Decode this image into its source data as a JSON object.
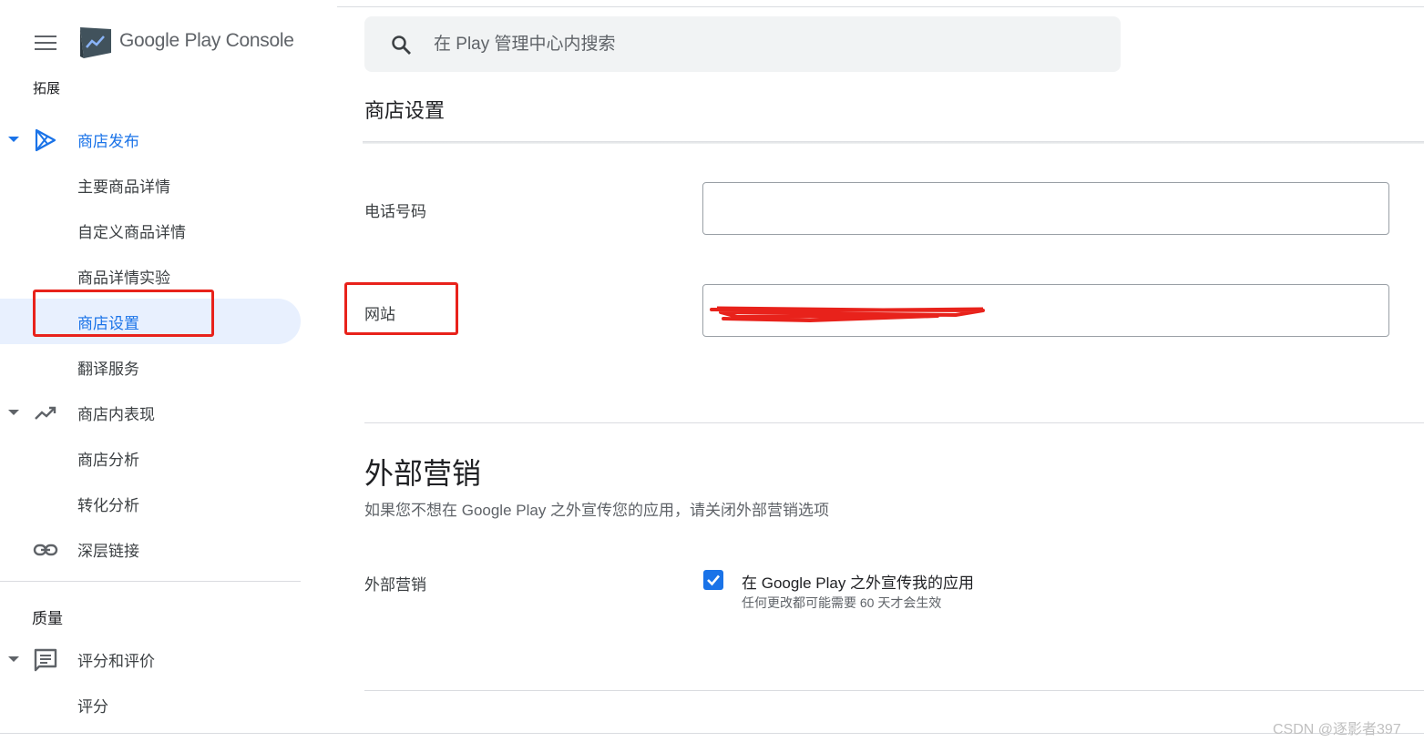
{
  "app": {
    "name_part1": "Google Play",
    "name_part2": "Console"
  },
  "sidebar": {
    "section_cut_label": "拓展",
    "items": [
      {
        "label": "商店发布",
        "icon": "play-store-icon"
      },
      {
        "label": "主要商品详情"
      },
      {
        "label": "自定义商品详情"
      },
      {
        "label": "商品详情实验"
      },
      {
        "label": "商店设置"
      },
      {
        "label": "翻译服务"
      },
      {
        "label": "商店内表现",
        "icon": "trending-up-icon"
      },
      {
        "label": "商店分析"
      },
      {
        "label": "转化分析"
      },
      {
        "label": "深层链接",
        "icon": "link-icon"
      }
    ],
    "quality_title": "质量",
    "quality_items": [
      {
        "label": "评分和评价",
        "icon": "reviews-icon"
      },
      {
        "label": "评分"
      }
    ]
  },
  "search": {
    "placeholder": "在 Play 管理中心内搜索"
  },
  "main": {
    "page_title": "商店设置",
    "phone_label": "电话号码",
    "phone_value": "",
    "website_label": "网站",
    "website_value": "",
    "external_title": "外部营销",
    "external_desc": "如果您不想在 Google Play 之外宣传您的应用，请关闭外部营销选项",
    "external_label": "外部营销",
    "checkbox_label": "在 Google Play 之外宣传我的应用",
    "checkbox_hint": "任何更改都可能需要 60 天才会生效",
    "checkbox_checked": true
  },
  "watermark": "CSDN @逐影者397",
  "colors": {
    "accent": "#1a73e8",
    "active_bg": "#e8f0fe",
    "annotation_red": "#e8221b"
  }
}
